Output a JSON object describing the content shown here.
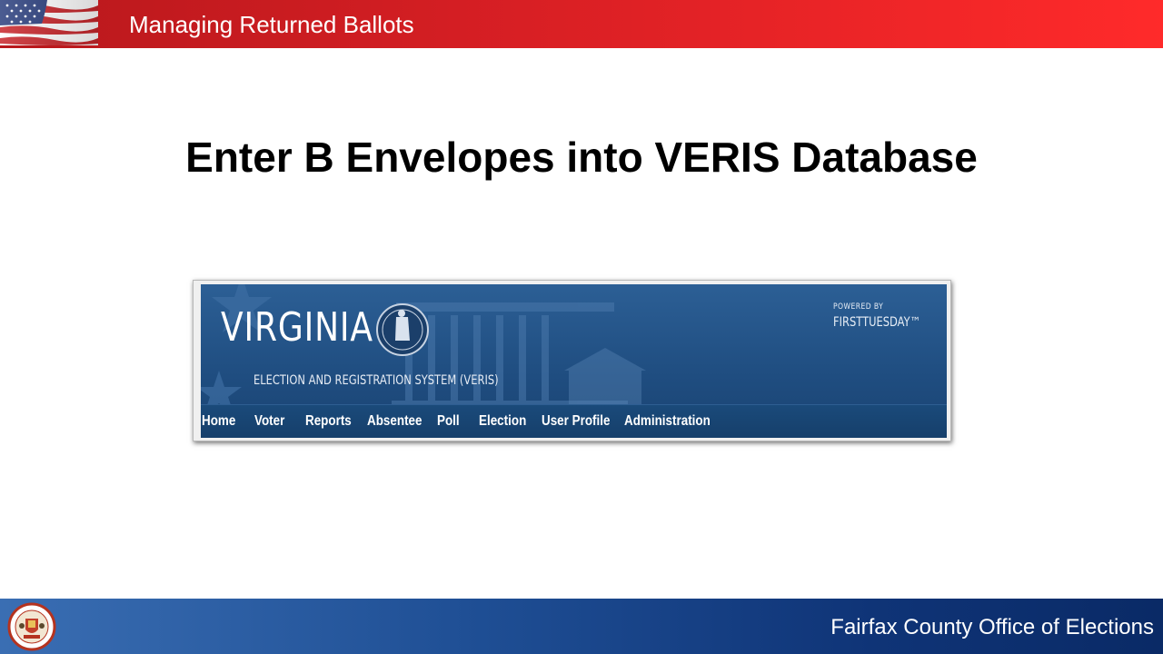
{
  "slide": {
    "header": "Managing Returned Ballots",
    "title": "Enter B Envelopes into VERIS Database",
    "footer": "Fairfax County Office of Elections"
  },
  "veris": {
    "brand": "VIRGINIA",
    "subtitle": "ELECTION AND REGISTRATION SYSTEM (VERIS)",
    "powered_label": "POWERED BY",
    "vendor": "FIRSTTUESDAY™",
    "menu": [
      {
        "label": "Home",
        "name": "home"
      },
      {
        "label": "Voter",
        "name": "voter"
      },
      {
        "label": "Reports",
        "name": "reports"
      },
      {
        "label": "Absentee",
        "name": "absentee"
      },
      {
        "label": "Poll",
        "name": "poll"
      },
      {
        "label": "Election",
        "name": "election"
      },
      {
        "label": "User Profile",
        "name": "user-profile"
      },
      {
        "label": "Administration",
        "name": "administration"
      }
    ]
  },
  "seal": {
    "ring_text": "COUNTY OF FAIRFAX",
    "year": "1742",
    "state": "VIRGINIA"
  },
  "colors": {
    "header_red": "#d81f24",
    "footer_blue": "#1f4f95",
    "banner_blue": "#1f4d80"
  },
  "icons": {
    "flag": "us-flag-icon",
    "seal": "county-seal-icon"
  }
}
